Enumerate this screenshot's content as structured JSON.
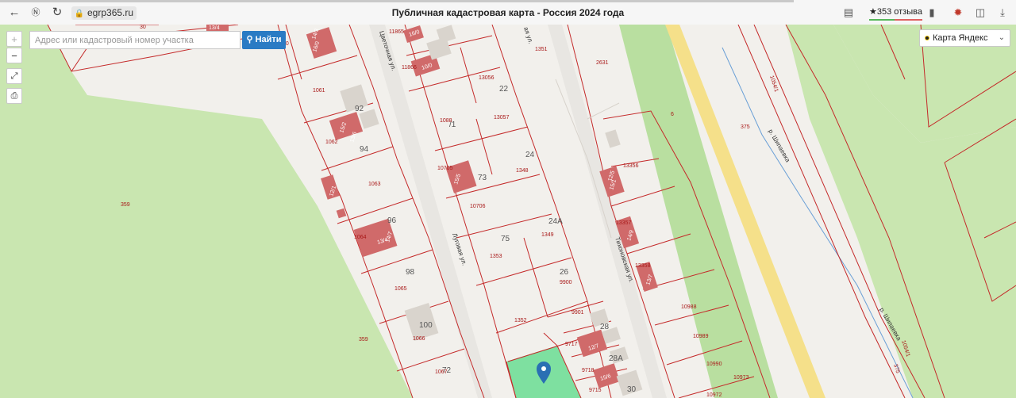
{
  "browser": {
    "url": "egrp365.ru",
    "title": "Публичная кадастровая карта - Россия 2024 года",
    "reviews": "★353 отзыва",
    "icons": [
      "back-icon",
      "yandex-icon",
      "reload-icon",
      "lock-icon",
      "reader-mode-icon",
      "bookmark-icon",
      "extension-icon",
      "collections-icon",
      "download-icon"
    ]
  },
  "search": {
    "placeholder": "Адрес или кадастровый номер участка",
    "button": "Найти",
    "button_icon": "search-icon"
  },
  "controls": {
    "zoom_in": "+",
    "zoom_out": "−",
    "fullscreen_icon": "expand-icon",
    "print_icon": "print-icon"
  },
  "layer": {
    "selected": "Карта Яндекс"
  },
  "map": {
    "street_labels": {
      "left": "Цветочная ул.",
      "middle": "Луговая ул.",
      "right": "Тихоновская ул.",
      "upper": "ая ул.",
      "river1": "р. Шипаевка",
      "river2": "р. Шипаевка"
    },
    "house_numbers": [
      "92",
      "94",
      "96",
      "98",
      "100",
      "72",
      "22",
      "24",
      "73",
      "24А",
      "75",
      "26",
      "28",
      "28А",
      "30",
      "/1"
    ],
    "plot_numbers": [
      "30",
      "30",
      "1061",
      "1062",
      "1063",
      "1064",
      "1065",
      "1066",
      "1067",
      "359",
      "359",
      "1088",
      "10705",
      "10706",
      "1353",
      "1352",
      "13056",
      "13057",
      "1348",
      "1349",
      "9900",
      "9901",
      "9717",
      "9718",
      "9715",
      "11865",
      "11866",
      "1351",
      "2631",
      "6",
      "375",
      "375",
      "13356",
      "13357",
      "13358",
      "10988",
      "10989",
      "10990",
      "10973",
      "10972",
      "1054/1",
      "1054/1"
    ],
    "building_labels": [
      "16/0",
      "10/0",
      "16/0",
      "15/2",
      "13/6",
      "12/1",
      "13/4",
      "14/7",
      "15/5",
      "15/1",
      "14/9",
      "13/7",
      "12/7",
      "15/6",
      "13/4",
      "14/3",
      "12/5"
    ]
  },
  "colors": {
    "boundary": "#c42a2a",
    "building": "#d06a6a",
    "green": "#c9e6b0",
    "selected_plot": "#7ee0a0",
    "pin": "#2a6fb3",
    "accent_button": "#2a7bc4"
  }
}
